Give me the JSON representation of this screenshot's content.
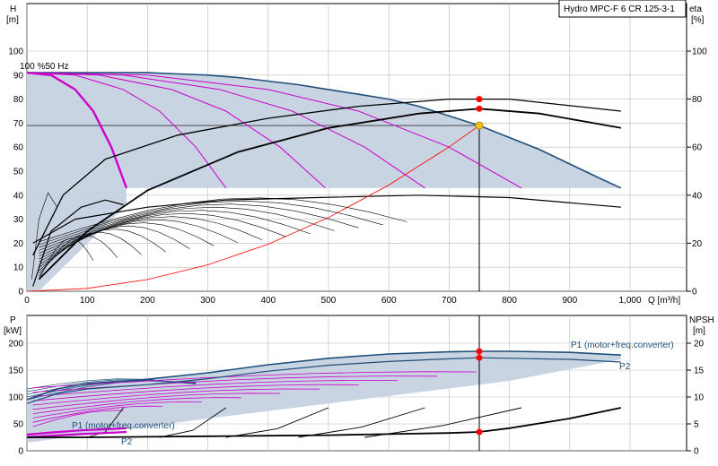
{
  "chart_data": [
    {
      "type": "line",
      "title": "Hydro MPC-F 6 CR 125-3-1",
      "annotation": "100 %50 Hz",
      "left_axis": {
        "label": "H",
        "unit": "[m]",
        "range": [
          0,
          120
        ],
        "ticks": [
          0,
          10,
          20,
          30,
          40,
          50,
          60,
          70,
          80,
          90,
          100
        ]
      },
      "right_axis": {
        "label": "eta",
        "unit": "[%]",
        "range": [
          0,
          100
        ],
        "ticks": [
          0,
          20,
          40,
          60,
          80,
          100
        ]
      },
      "x_axis": {
        "label": "Q [m³/h]",
        "range": [
          0,
          1050
        ],
        "ticks": [
          0,
          100,
          200,
          300,
          400,
          500,
          600,
          700,
          800,
          900,
          1000
        ],
        "tick_labels": [
          "0",
          "100",
          "200",
          "300",
          "400",
          "500",
          "600",
          "700",
          "800",
          "900",
          "1,000"
        ]
      },
      "grid": true,
      "colors": {
        "envelope": "#1f4e79",
        "fill": "#c8d4e2",
        "magenta": "#cc00cc",
        "system": "#ff0000",
        "duty": "#f5c518"
      },
      "duty_point": {
        "q": 750,
        "h": 69
      },
      "eta_points": [
        {
          "q": 750,
          "eta": 80
        },
        {
          "q": 750,
          "eta": 76
        }
      ],
      "series": [
        {
          "role": "envelope",
          "x": [
            0,
            50,
            100,
            150,
            200,
            250,
            300,
            350,
            400,
            450,
            500,
            550,
            600,
            650,
            700,
            750,
            800,
            850,
            900,
            950,
            985
          ],
          "y": [
            91,
            91,
            91,
            91,
            91,
            90.5,
            90,
            89,
            87.5,
            86,
            84,
            82,
            80,
            77,
            73,
            69,
            64,
            59,
            53,
            47,
            43
          ]
        },
        {
          "role": "one_pump",
          "x": [
            0,
            40,
            80,
            110,
            140,
            165
          ],
          "y": [
            91,
            90,
            84,
            75,
            60,
            43
          ]
        },
        {
          "role": "two_pumps",
          "x": [
            0,
            80,
            160,
            220,
            280,
            330
          ],
          "y": [
            91,
            90,
            84,
            75,
            60,
            43
          ]
        },
        {
          "role": "three_pumps",
          "x": [
            0,
            120,
            240,
            330,
            420,
            495
          ],
          "y": [
            91,
            90,
            84,
            75,
            60,
            43
          ]
        },
        {
          "role": "four_pumps",
          "x": [
            0,
            160,
            320,
            440,
            560,
            660
          ],
          "y": [
            91,
            90,
            84,
            75,
            60,
            43
          ]
        },
        {
          "role": "five_pumps",
          "x": [
            0,
            200,
            400,
            550,
            700,
            820
          ],
          "y": [
            91,
            90,
            84,
            75,
            60,
            43
          ]
        },
        {
          "role": "system_curve",
          "x": [
            0,
            100,
            200,
            300,
            400,
            500,
            600,
            700,
            750
          ],
          "y": [
            0,
            1.2,
            4.9,
            11,
            19.6,
            30.7,
            44.2,
            60.1,
            69
          ]
        },
        {
          "role": "eta_envelope",
          "x": [
            10,
            60,
            130,
            250,
            400,
            550,
            700,
            800,
            985
          ],
          "y": [
            15,
            40,
            55,
            65,
            72,
            77,
            80,
            80,
            75
          ]
        },
        {
          "role": "eta_duty",
          "x": [
            20,
            100,
            200,
            350,
            500,
            650,
            750,
            850,
            985
          ],
          "y": [
            5,
            25,
            42,
            58,
            68,
            74,
            76,
            74,
            68
          ]
        }
      ]
    },
    {
      "type": "line",
      "left_axis": {
        "label": "P",
        "unit": "[kW]",
        "range": [
          0,
          225
        ],
        "ticks": [
          0,
          50,
          100,
          150,
          200
        ]
      },
      "right_axis": {
        "label": "NPSH",
        "unit": "[m]",
        "range": [
          0,
          22.5
        ],
        "ticks": [
          0,
          5,
          10,
          15,
          20
        ]
      },
      "x_axis": {
        "range": [
          0,
          1050
        ]
      },
      "grid": true,
      "labels": {
        "p1_main": "P1 (motor+freq.converter)",
        "p2_main": "P2",
        "p1_low": "P1 (motor+freq.converter)",
        "p2_low": "P2"
      },
      "points": [
        {
          "q": 750,
          "p": 185
        },
        {
          "q": 750,
          "p": 173
        },
        {
          "q": 750,
          "npsh": 3.5
        }
      ],
      "series": [
        {
          "role": "p1_envelope",
          "x": [
            0,
            50,
            100,
            200,
            300,
            400,
            500,
            600,
            700,
            750,
            800,
            900,
            985
          ],
          "y": [
            95,
            115,
            125,
            133,
            145,
            160,
            172,
            180,
            184,
            185,
            185,
            183,
            178
          ]
        },
        {
          "role": "p2_envelope",
          "x": [
            0,
            50,
            100,
            200,
            300,
            400,
            500,
            600,
            700,
            750,
            800,
            900,
            985
          ],
          "y": [
            88,
            106,
            115,
            123,
            134,
            148,
            159,
            166,
            171,
            173,
            172,
            170,
            165
          ]
        },
        {
          "role": "p1_low",
          "x": [
            0,
            40,
            90,
            130,
            165
          ],
          "y": [
            30,
            34,
            38,
            40,
            42
          ]
        },
        {
          "role": "p2_low",
          "x": [
            0,
            40,
            90,
            130,
            165
          ],
          "y": [
            25,
            28,
            31,
            33,
            35
          ]
        },
        {
          "role": "npsh_main",
          "x": [
            0,
            100,
            200,
            300,
            400,
            500,
            600,
            700,
            750,
            800,
            900,
            985
          ],
          "y": [
            2.5,
            2.5,
            2.6,
            2.7,
            2.8,
            2.9,
            3.1,
            3.3,
            3.5,
            4.2,
            6,
            8
          ]
        }
      ]
    }
  ]
}
